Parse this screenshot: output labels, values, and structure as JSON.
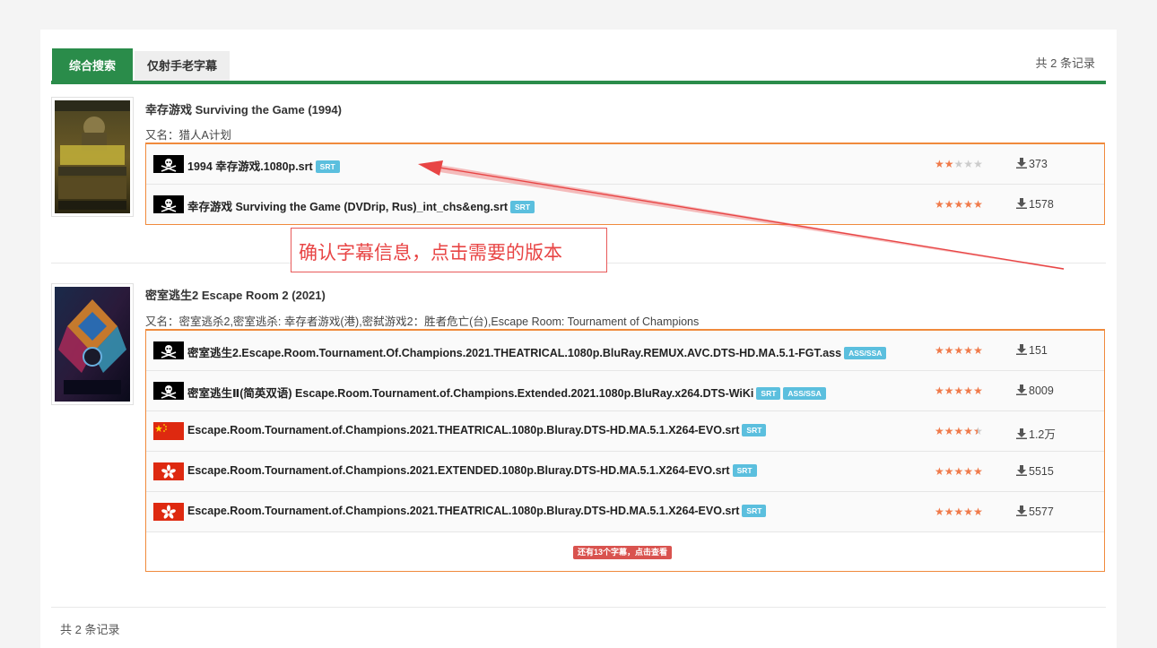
{
  "tabs": {
    "active_label": "综合搜索",
    "inactive_label": "仅射手老字幕"
  },
  "total_top": "共 2 条记录",
  "total_bottom": "共 2 条记录",
  "annotation": "确认字幕信息，点击需要的版本",
  "movies": [
    {
      "title": "幸存游戏 Surviving the Game (1994)",
      "alias": "又名：猎人A计划",
      "subtitles": [
        {
          "flag": "pirate-icon",
          "name": "1994 幸存游戏.1080p.srt",
          "badges": [
            "SRT"
          ],
          "rating": 2,
          "downloads": "373"
        },
        {
          "flag": "pirate-icon",
          "name": "幸存游戏 Surviving the Game (DVDrip, Rus)_int_chs&eng.srt",
          "badges": [
            "SRT"
          ],
          "rating": 5,
          "downloads": "1578"
        }
      ]
    },
    {
      "title": "密室逃生2 Escape Room 2 (2021)",
      "alias": "又名：密室逃杀2,密室逃杀: 幸存者游戏(港),密弑游戏2：胜者危亡(台),Escape Room: Tournament of Champions",
      "subtitles": [
        {
          "flag": "pirate-icon",
          "name": "密室逃生2.Escape.Room.Tournament.Of.Champions.2021.THEATRICAL.1080p.BluRay.REMUX.AVC.DTS-HD.MA.5.1-FGT.ass",
          "badges": [
            "ASS/SSA"
          ],
          "rating": 5,
          "downloads": "151"
        },
        {
          "flag": "pirate-icon",
          "name": "密室逃生Ⅱ(简英双语) Escape.Room.Tournament.of.Champions.Extended.2021.1080p.BluRay.x264.DTS-WiKi",
          "badges": [
            "SRT",
            "ASS/SSA"
          ],
          "rating": 5,
          "downloads": "8009"
        },
        {
          "flag": "china-flag-icon",
          "name": "Escape.Room.Tournament.of.Champions.2021.THEATRICAL.1080p.Bluray.DTS-HD.MA.5.1.X264-EVO.srt",
          "badges": [
            "SRT"
          ],
          "rating": 4.5,
          "downloads": "1.2万"
        },
        {
          "flag": "hongkong-flag-icon",
          "name": "Escape.Room.Tournament.of.Champions.2021.EXTENDED.1080p.Bluray.DTS-HD.MA.5.1.X264-EVO.srt",
          "badges": [
            "SRT"
          ],
          "rating": 5,
          "downloads": "5515"
        },
        {
          "flag": "hongkong-flag-icon",
          "name": "Escape.Room.Tournament.of.Champions.2021.THEATRICAL.1080p.Bluray.DTS-HD.MA.5.1.X264-EVO.srt",
          "badges": [
            "SRT"
          ],
          "rating": 5,
          "downloads": "5577"
        }
      ],
      "more_label": "还有13个字幕，点击查看"
    }
  ],
  "colors": {
    "accent_green": "#2a8c4a",
    "table_border_orange": "#f08a3c",
    "badge_blue": "#5bbfde",
    "star_orange": "#f07a4a",
    "annotation_red": "#e84545",
    "more_button_red": "#d9534f"
  }
}
